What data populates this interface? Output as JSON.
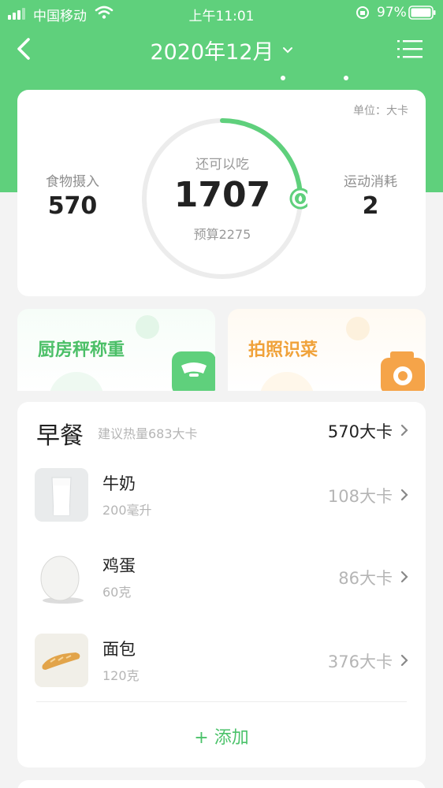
{
  "status_bar": {
    "carrier": "中国移动",
    "time": "上午11:01",
    "battery": "97%"
  },
  "nav": {
    "title": "2020年12月",
    "icons": [
      "back-arrow-icon",
      "chevron-down-icon",
      "menu-icon"
    ]
  },
  "summary": {
    "unit": "单位：大卡",
    "intake_label": "食物摄入",
    "intake_value": "570",
    "remaining_label": "还可以吃",
    "remaining_value": "1707",
    "budget_label": "预算2275",
    "exercise_label": "运动消耗",
    "exercise_value": "2",
    "progress_fraction": 0.25,
    "accent_color": "#5fd07c"
  },
  "features": [
    {
      "label": "厨房秤称重",
      "color": "#4bbf67"
    },
    {
      "label": "拍照识菜",
      "color": "#f0a23a"
    }
  ],
  "meal": {
    "title": "早餐",
    "hint": "建议热量683大卡",
    "total": "570大卡",
    "items": [
      {
        "name": "牛奶",
        "amount": "200毫升",
        "kcal": "108大卡"
      },
      {
        "name": "鸡蛋",
        "amount": "60克",
        "kcal": "86大卡"
      },
      {
        "name": "面包",
        "amount": "120克",
        "kcal": "376大卡"
      }
    ],
    "add_label": "添加"
  }
}
